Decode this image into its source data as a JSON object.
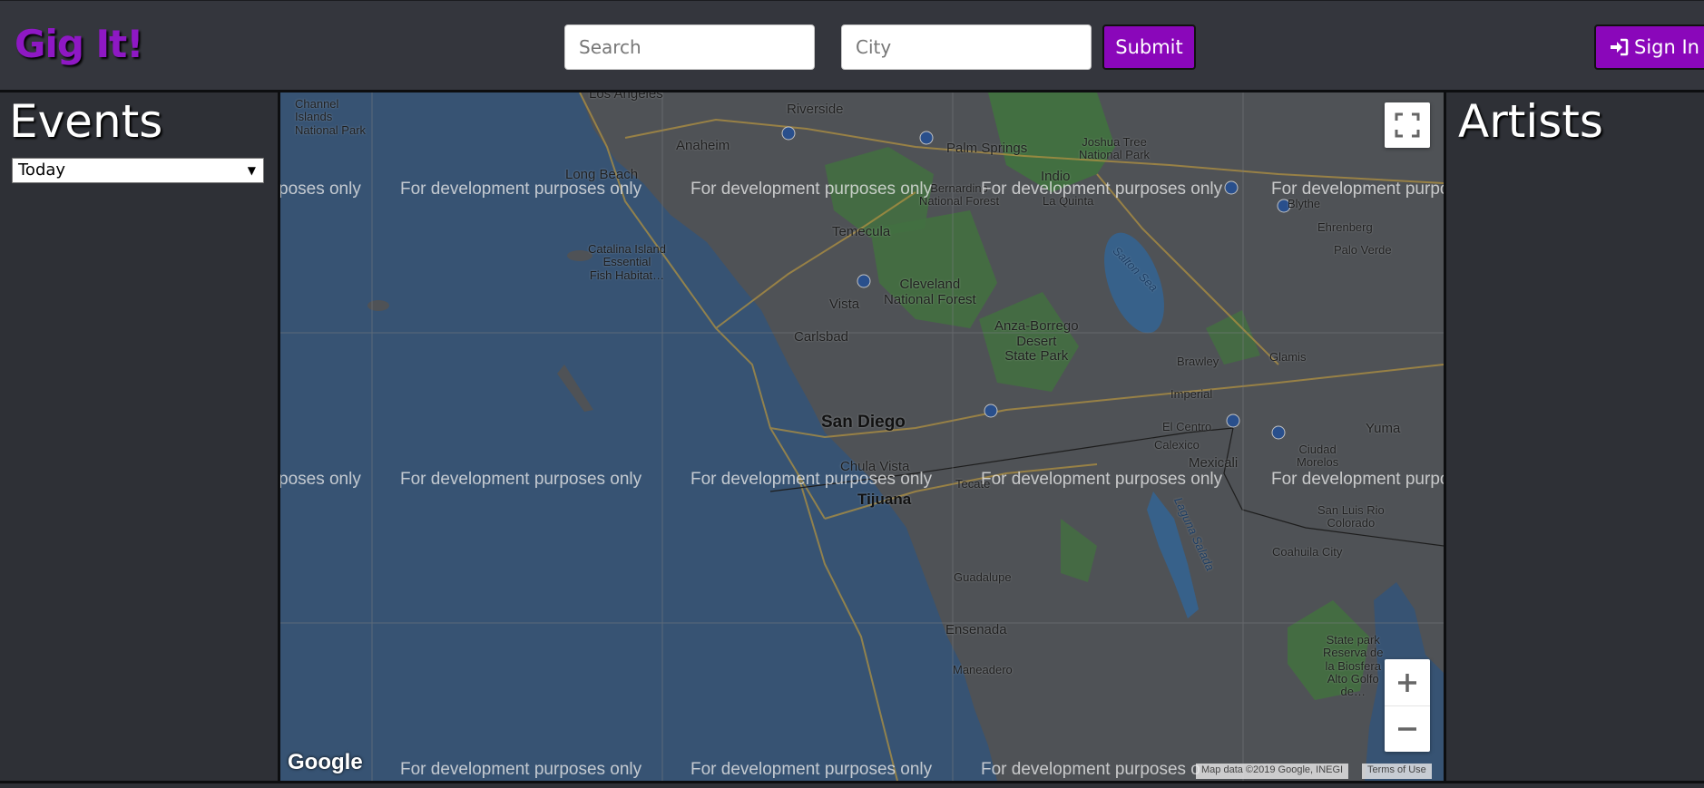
{
  "navbar": {
    "brand": "Gig It!",
    "search_placeholder": "Search",
    "city_placeholder": "City",
    "submit_label": "Submit",
    "signin_label": "Sign In"
  },
  "events": {
    "title": "Events",
    "date_filter": "Today"
  },
  "artists": {
    "title": "Artists"
  },
  "map": {
    "watermark": "For development purposes only",
    "watermark_left_cut": "poses only",
    "watermark_right_cut": "For development purpo",
    "watermark_bottom_right_cut": "For development purposes o",
    "attribution": "Map data ©2019 Google, INEGI",
    "terms": "Terms of Use",
    "logo": "Google",
    "zoom_in": "+",
    "zoom_out": "−",
    "places": {
      "los_angeles": "Los Angeles",
      "channel_islands": "Channel\nIslands\nNational Park",
      "riverside": "Riverside",
      "anaheim": "Anaheim",
      "long_beach": "Long Beach",
      "palm_springs": "Palm Springs",
      "joshua_tree": "Joshua Tree\nNational Park",
      "indio": "Indio",
      "la_quinta": "La Quinta",
      "san_bernardino": "San\nBernardino\nNational Forest",
      "temecula": "Temecula",
      "catalina": "Catalina Island\nEssential\nFish Habitat…",
      "cleveland": "Cleveland\nNational Forest",
      "vista": "Vista",
      "carlsbad": "Carlsbad",
      "anza_borrego": "Anza-Borrego\nDesert\nState Park",
      "salton_sea": "Salton Sea",
      "blythe": "Blythe",
      "ehrenberg": "Ehrenberg",
      "palo_verde": "Palo Verde",
      "glamis": "Glamis",
      "brawley": "Brawley",
      "imperial": "Imperial",
      "el_centro": "El Centro",
      "calexico": "Calexico",
      "mexicali": "Mexicali",
      "san_diego": "San Diego",
      "chula_vista": "Chula Vista",
      "tijuana": "Tijuana",
      "tecate": "Tecate",
      "yuma": "Yuma",
      "ciudad_morelos": "Ciudad\nMorelos",
      "san_luis_rio": "San Luis Rio\nColorado",
      "laguna_salada": "Laguna Salada",
      "coahuila_city": "Coahuila City",
      "guadalupe": "Guadalupe",
      "ensenada": "Ensenada",
      "maneadero": "Maneadero",
      "state_park": "State park\nReserva de\nla Biosfera\nAlto Golfo\nde…"
    }
  },
  "colors": {
    "brand": "#8e18c4",
    "button": "#8a07ba",
    "ocean": "#3f5f83",
    "land": "#5b5e62",
    "forest": "#4c7f4a"
  }
}
